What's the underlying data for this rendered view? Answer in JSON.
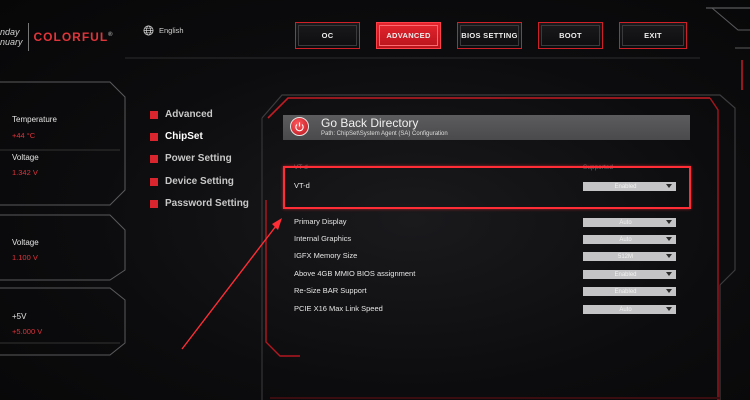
{
  "header": {
    "logo_line1": "nday",
    "logo_line2": "nuary",
    "brand": "COLORFUL",
    "brand_mark": "®",
    "language": "English"
  },
  "top_nav": [
    {
      "label": "OC",
      "active": false
    },
    {
      "label": "ADVANCED",
      "active": true
    },
    {
      "label": "BIOS SETTING",
      "active": false
    },
    {
      "label": "BOOT",
      "active": false
    },
    {
      "label": "EXIT",
      "active": false
    }
  ],
  "monitor": [
    {
      "label": "Temperature",
      "value": "+44 °C"
    },
    {
      "label": "Voltage",
      "value": "1.342 V"
    },
    {
      "label": "Voltage",
      "value": "1.100 V"
    },
    {
      "label": "+5V",
      "value": "+5.000 V"
    }
  ],
  "categories": [
    {
      "label": "Advanced",
      "active": false
    },
    {
      "label": "ChipSet",
      "active": true
    },
    {
      "label": "Power Setting",
      "active": false
    },
    {
      "label": "Device Setting",
      "active": false
    },
    {
      "label": "Password Setting",
      "active": false
    }
  ],
  "directory": {
    "title": "Go Back Directory",
    "path": "Path: ChipSet\\System Agent (SA) Configuration"
  },
  "column_headers": {
    "left": "VT-d",
    "right": "Supported"
  },
  "settings": [
    {
      "label": "VT-d",
      "value": "Enabled"
    },
    {
      "label": "Primary Display",
      "value": "Auto"
    },
    {
      "label": "Internal Graphics",
      "value": "Auto"
    },
    {
      "label": "IGFX Memory Size",
      "value": "512M"
    },
    {
      "label": "Above 4GB MMIO BIOS assignment",
      "value": "Enabled"
    },
    {
      "label": "Re-Size BAR Support",
      "value": "Enabled"
    },
    {
      "label": "PCIE X16 Max Link Speed",
      "value": "Auto"
    }
  ],
  "colors": {
    "accent": "#d8252e",
    "highlight": "#ff2d35",
    "value_red": "#e0323a",
    "dropdown": "#c4c4c6"
  },
  "icons": {
    "language": "globe-icon",
    "back": "back-circle-icon",
    "dropdown": "chevron-down-icon"
  }
}
